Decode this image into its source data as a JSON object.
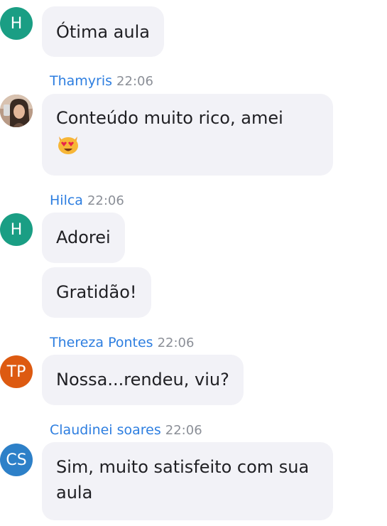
{
  "colors": {
    "name_blue": "#2d7ee0",
    "time_gray": "#8b8f97",
    "bubble_bg": "#f2f2f7",
    "avatar_green": "#1a9e84",
    "avatar_orange": "#dd5a11",
    "avatar_blue": "#2d80c8"
  },
  "messages": [
    {
      "avatar_initials": "H",
      "bubbles": [
        "Ótima aula"
      ]
    },
    {
      "author": "Thamyris",
      "time": "22:06",
      "avatar_icon": "user-photo-avatar",
      "bubbles": [
        "Conteúdo muito rico, amei"
      ],
      "emoji": "heart-eyes-cat-emoji"
    },
    {
      "author": "Hilca",
      "time": "22:06",
      "avatar_initials": "H",
      "bubbles": [
        "Adorei",
        "Gratidão!"
      ]
    },
    {
      "author": "Thereza Pontes",
      "time": "22:06",
      "avatar_initials": "TP",
      "bubbles": [
        "Nossa...rendeu, viu?"
      ]
    },
    {
      "author": "Claudinei soares",
      "time": "22:06",
      "avatar_initials": "CS",
      "bubbles": [
        "Sim, muito satisfeito com sua",
        "aula"
      ]
    }
  ]
}
